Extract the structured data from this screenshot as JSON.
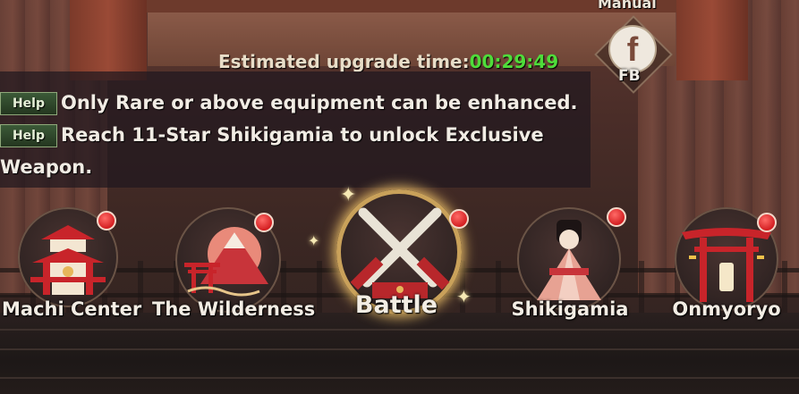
{
  "top_right": {
    "manual_label": "Manual",
    "fb_icon_letter": "f",
    "fb_label": "FB"
  },
  "info": {
    "upgrade_label": "Estimated upgrade time:",
    "upgrade_time": "00:29:49",
    "help_tag": "Help",
    "tips": [
      "Only Rare or above equipment can be enhanced.",
      "Reach 11-Star Shikigamia to unlock Exclusive Weapon."
    ]
  },
  "nav": [
    {
      "label": "Machi Center",
      "icon": "pagoda-icon",
      "badge": "red-dot"
    },
    {
      "label": "The Wilderness",
      "icon": "mountain-torii-icon",
      "badge": "red-dot"
    },
    {
      "label": "Battle",
      "icon": "crossed-swords-icon",
      "badge": "red-dot",
      "selected": true
    },
    {
      "label": "Shikigamia",
      "icon": "kimono-girl-icon",
      "badge": "red-dot"
    },
    {
      "label": "Onmyoryo",
      "icon": "torii-gate-icon",
      "badge": "red-dot"
    }
  ],
  "colors": {
    "timer_green": "#4fdc3a",
    "badge_red": "#d41f22",
    "help_green": "#3c5a38"
  }
}
